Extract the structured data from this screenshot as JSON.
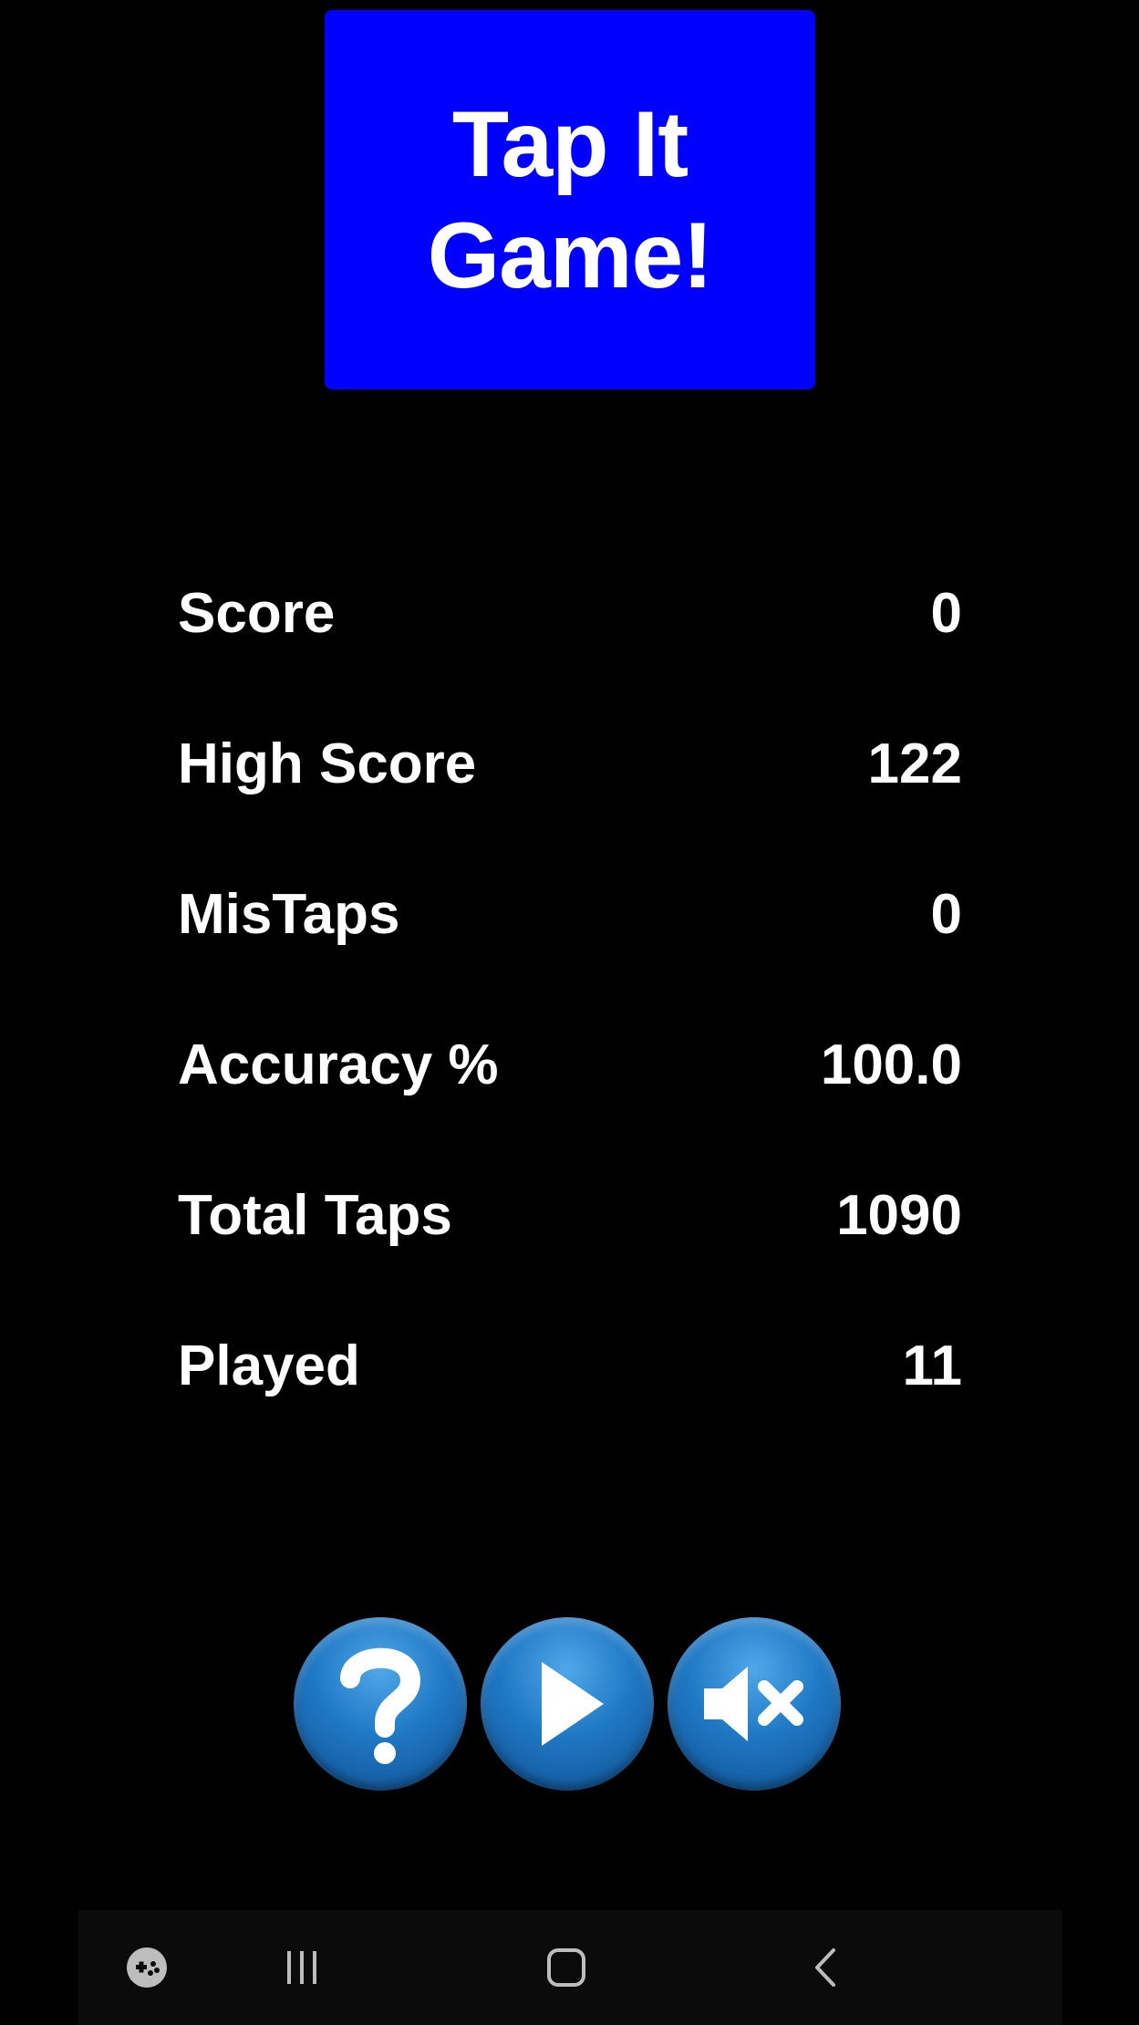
{
  "app": {
    "title": "Tap It\nGame!",
    "title_bg_color": "#0000ff"
  },
  "stats": [
    {
      "label": "Score",
      "value": "0"
    },
    {
      "label": "High Score",
      "value": "122"
    },
    {
      "label": "MisTaps",
      "value": "0"
    },
    {
      "label": "Accuracy %",
      "value": "100.0"
    },
    {
      "label": "Total Taps",
      "value": "1090"
    },
    {
      "label": "Played",
      "value": "11"
    }
  ],
  "controls": {
    "help_icon": "question-icon",
    "play_icon": "play-icon",
    "mute_icon": "speaker-muted-icon",
    "button_color": "#1f78c4"
  },
  "navbar": {
    "icons": [
      "game-launcher-icon",
      "recent-apps-icon",
      "home-icon",
      "back-icon"
    ]
  }
}
